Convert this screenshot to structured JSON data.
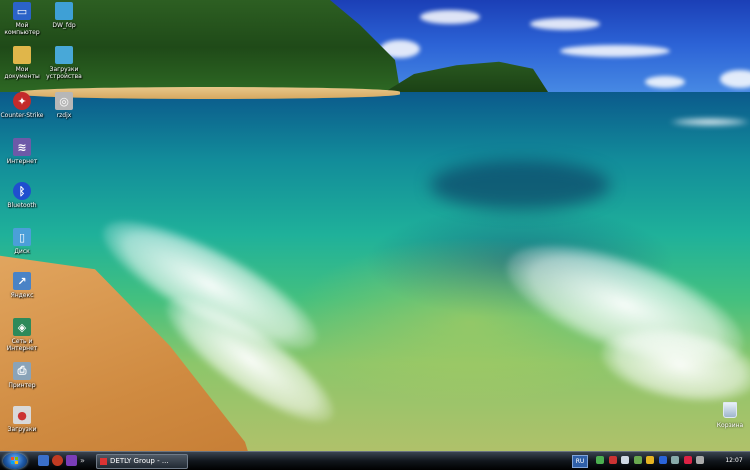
{
  "desktop": {
    "icons": [
      {
        "label": "Мой компьютер",
        "icon": "my-computer-icon",
        "color": "#2b63c8"
      },
      {
        "label": "DW_fdp",
        "icon": "file-icon",
        "color": "#3ea0d6"
      },
      {
        "label": "Мои документы",
        "icon": "documents-folder-icon",
        "color": "#e0b64a"
      },
      {
        "label": "Загрузки устройства",
        "icon": "download-file-icon",
        "color": "#48a8d8"
      },
      {
        "label": "Counter-Strike",
        "icon": "cs-icon",
        "color": "#c42b2b"
      },
      {
        "label": "rzdjx",
        "icon": "video-file-icon",
        "color": "#b7b7b7"
      },
      {
        "label": "Интернет",
        "icon": "network-icon",
        "color": "#6d5aa8"
      },
      {
        "label": "Bluetooth",
        "icon": "bluetooth-icon",
        "color": "#1f4fcf"
      },
      {
        "label": "Диск",
        "icon": "disk-icon",
        "color": "#4b9fd9"
      },
      {
        "label": "Яндекс",
        "icon": "shortcut-icon",
        "color": "#4a83c6"
      },
      {
        "label": "Сеть и Интернет",
        "icon": "network-icon",
        "color": "#2d8a5a"
      },
      {
        "label": "Принтер",
        "icon": "printer-icon",
        "color": "#8aa3b8"
      },
      {
        "label": "Загрузки",
        "icon": "media-icon",
        "color": "#d9d9d9"
      }
    ],
    "recycle_bin": {
      "label": "Корзина",
      "icon": "recycle-bin-icon"
    }
  },
  "taskbar": {
    "start_icon": "windows-start-icon",
    "quick_launch": [
      {
        "icon": "show-desktop-icon",
        "color": "#3a6fc9"
      },
      {
        "icon": "browser-icon",
        "color": "#c23b22"
      },
      {
        "icon": "media-player-icon",
        "color": "#7a3db8"
      }
    ],
    "task_button": {
      "label": "DETLY Group - ...",
      "icon": "app-icon"
    },
    "language": "RU",
    "tray_icons": [
      {
        "icon": "network-tray-icon",
        "color": "#4caf50"
      },
      {
        "icon": "antivirus-tray-icon",
        "color": "#c33"
      },
      {
        "icon": "volume-tray-icon",
        "color": "#cfd8e3"
      },
      {
        "icon": "battery-tray-icon",
        "color": "#6aa84f"
      },
      {
        "icon": "update-tray-icon",
        "color": "#e6b422"
      },
      {
        "icon": "bluetooth-tray-icon",
        "color": "#2a63d8"
      },
      {
        "icon": "display-tray-icon",
        "color": "#8aa"
      },
      {
        "icon": "shield-tray-icon",
        "color": "#d24"
      },
      {
        "icon": "usb-tray-icon",
        "color": "#aaa"
      }
    ],
    "clock": "12:07"
  }
}
